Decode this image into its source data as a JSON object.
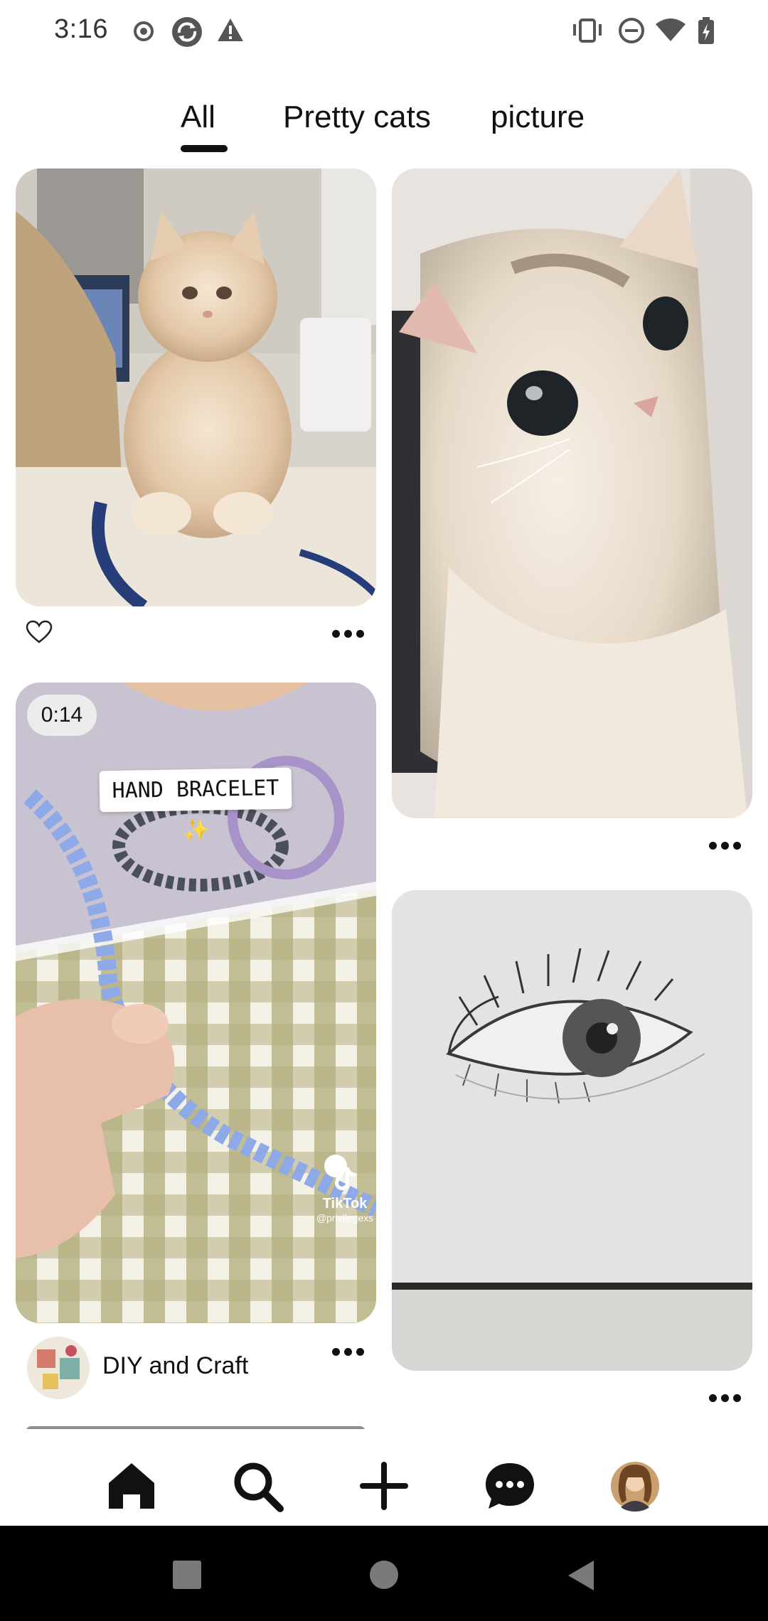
{
  "status_bar": {
    "time": "3:16",
    "left_icons": [
      "record-icon",
      "sync-icon",
      "warning-icon"
    ],
    "right_icons": [
      "vibrate-icon",
      "do-not-disturb-icon",
      "wifi-icon",
      "battery-charging-icon"
    ]
  },
  "tabs": [
    {
      "label": "All",
      "selected": true
    },
    {
      "label": "Pretty cats",
      "selected": false
    },
    {
      "label": "picture",
      "selected": false
    }
  ],
  "feed": {
    "pins": [
      {
        "id": "kitten",
        "image": "fluffy cream kitten standing on rug",
        "actions": [
          "heart-icon",
          "more-icon"
        ]
      },
      {
        "id": "cat-closeup",
        "image": "cream cat close-up",
        "actions": [
          "more-icon"
        ]
      },
      {
        "id": "bracelet",
        "image": "hand bracelet video",
        "duration": "0:14",
        "overlay_text": "HAND BRACELET ✨",
        "watermark": "TikTok",
        "watermark_handle": "@privilegexs",
        "author": "DIY and Craft",
        "actions": [
          "more-icon"
        ]
      },
      {
        "id": "eye-sketch",
        "image": "pencil eye sketch",
        "actions": [
          "more-icon"
        ]
      }
    ]
  },
  "bottom_nav": [
    {
      "icon": "home-icon",
      "selected": true
    },
    {
      "icon": "search-icon",
      "selected": false
    },
    {
      "icon": "plus-icon",
      "selected": false
    },
    {
      "icon": "messages-icon",
      "selected": false
    },
    {
      "icon": "profile-avatar",
      "selected": false
    }
  ],
  "system_nav": [
    "recents-icon",
    "home-circle-icon",
    "back-icon"
  ]
}
